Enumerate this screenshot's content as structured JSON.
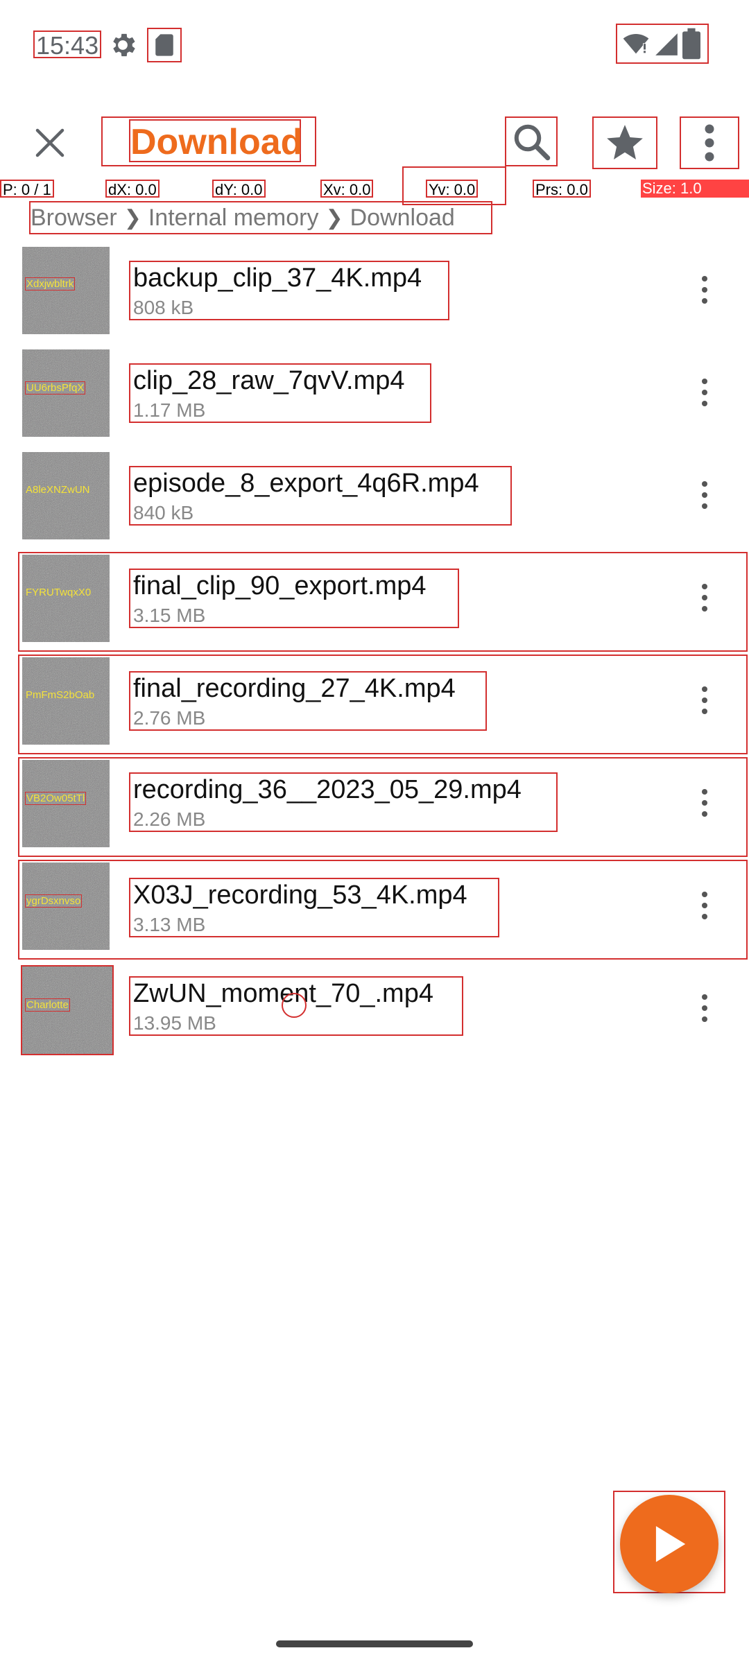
{
  "status_bar": {
    "time": "15:43",
    "icons": [
      "gear-icon",
      "sd-card-icon",
      "wifi-alert-icon",
      "signal-icon",
      "battery-icon"
    ]
  },
  "pointer_info": {
    "p": "P: 0 / 1",
    "dx": "dX: 0.0",
    "dy": "dY: 0.0",
    "xv": "Xv: 0.0",
    "yv": "Yv: 0.0",
    "prs": "Prs: 0.0",
    "size": "Size: 1.0"
  },
  "toolbar": {
    "title": "Download",
    "icons": [
      "close-icon",
      "search-icon",
      "star-icon",
      "more-vert-icon"
    ]
  },
  "breadcrumb": [
    "Browser",
    "Internal memory",
    "Download"
  ],
  "files": [
    {
      "name": "backup_clip_37_4K.mp4",
      "size": "808 kB",
      "thumb_text": "Xdxjwbltrk"
    },
    {
      "name": "clip_28_raw_7qvV.mp4",
      "size": "1.17 MB",
      "thumb_text": "UU6rbsPfqX"
    },
    {
      "name": "episode_8_export_4q6R.mp4",
      "size": "840 kB",
      "thumb_text": "A8leXNZwUN"
    },
    {
      "name": "final_clip_90_export.mp4",
      "size": "3.15 MB",
      "thumb_text": "FYRUTwqxX0"
    },
    {
      "name": "final_recording_27_4K.mp4",
      "size": "2.76 MB",
      "thumb_text": "PmFmS2bOab"
    },
    {
      "name": "recording_36__2023_05_29.mp4",
      "size": "2.26 MB",
      "thumb_text": "VB2Ow05tTl"
    },
    {
      "name": "X03J_recording_53_4K.mp4",
      "size": "3.13 MB",
      "thumb_text": "ygrDsxnvso"
    },
    {
      "name": "ZwUN_moment_70_.mp4",
      "size": "13.95 MB",
      "thumb_text": "Charlotte"
    }
  ],
  "fab": {
    "icon": "play-icon"
  },
  "colors": {
    "accent": "#ee6b1d",
    "annotation": "#d32f2f"
  }
}
